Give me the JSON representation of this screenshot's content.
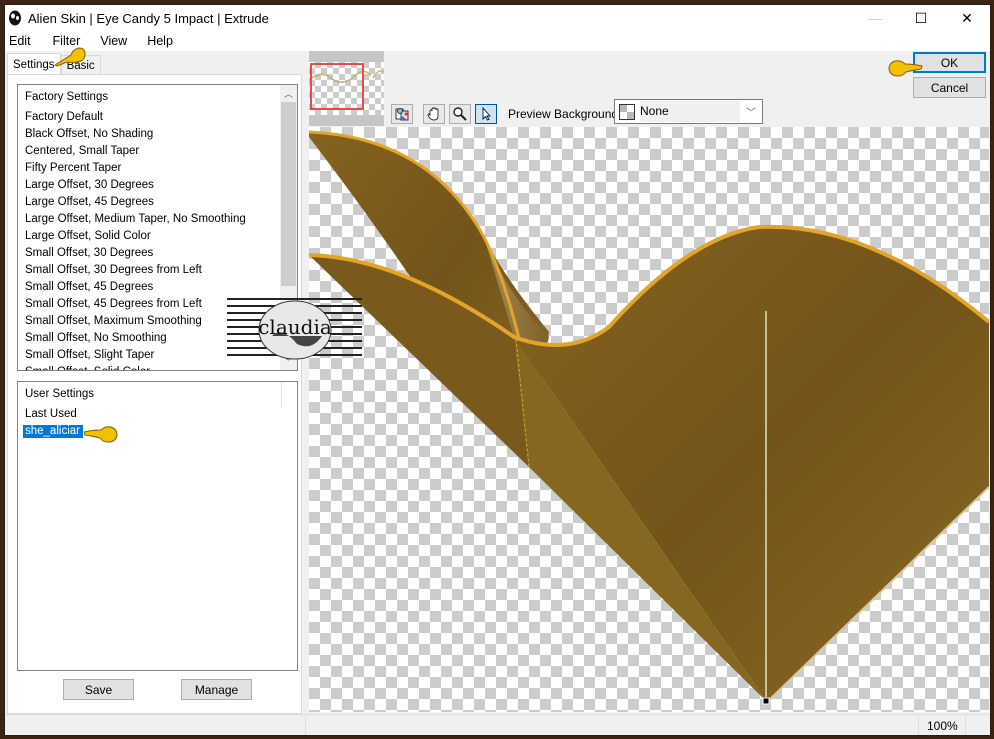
{
  "window": {
    "title": "Alien Skin | Eye Candy 5 Impact | Extrude",
    "controls": {
      "minimize": "—",
      "maximize": "☐",
      "close": "✕"
    }
  },
  "menu": [
    "Edit",
    "Filter",
    "View",
    "Help"
  ],
  "tabs": [
    {
      "label": "Settings",
      "active": true
    },
    {
      "label": "Basic",
      "active": false
    }
  ],
  "factory_settings": {
    "header": "Factory Settings",
    "items": [
      "Factory Default",
      "Black Offset, No Shading",
      "Centered, Small Taper",
      "Fifty Percent Taper",
      "Large Offset, 30 Degrees",
      "Large Offset, 45 Degrees",
      "Large Offset, Medium Taper, No Smoothing",
      "Large Offset, Solid Color",
      "Small Offset, 30 Degrees",
      "Small Offset, 30 Degrees from Left",
      "Small Offset, 45 Degrees",
      "Small Offset, 45 Degrees from Left",
      "Small Offset, Maximum Smoothing",
      "Small Offset, No Smoothing",
      "Small Offset, Slight Taper",
      "Small Offset, Solid Color"
    ]
  },
  "user_settings": {
    "header": "User Settings",
    "items": [
      {
        "label": "Last Used",
        "selected": false
      },
      {
        "label": "she_aliciar",
        "selected": true
      }
    ]
  },
  "buttons": {
    "save": "Save",
    "manage": "Manage",
    "ok": "OK",
    "cancel": "Cancel"
  },
  "toolbar": {
    "tools": [
      "preview-compare",
      "hand",
      "zoom",
      "pointer"
    ],
    "active_tool": "pointer"
  },
  "preview_background": {
    "label": "Preview Background:",
    "value": "None"
  },
  "watermark_text": "claudia",
  "status": {
    "zoom": "100%"
  },
  "colors": {
    "accent": "#0078d7",
    "extrude_fill": "#7a5a1e",
    "extrude_edge": "#e3a42a",
    "navigator_frame": "#e94a4a"
  }
}
